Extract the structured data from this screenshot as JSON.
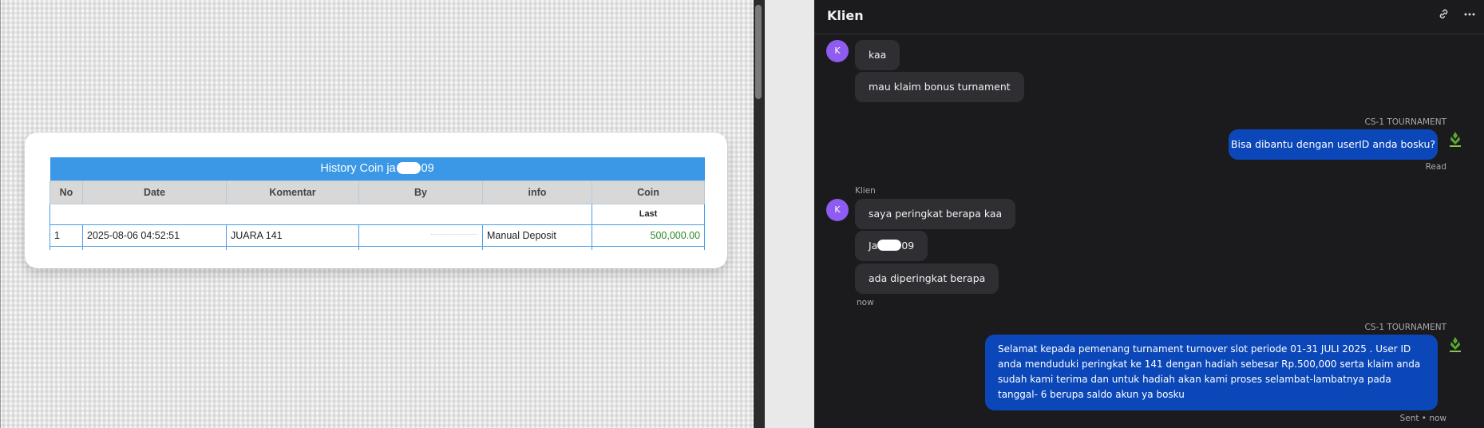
{
  "history": {
    "title_prefix": "History Coin ja",
    "title_suffix": "09",
    "columns": [
      "No",
      "Date",
      "Komentar",
      "By",
      "info",
      "Coin"
    ],
    "sub_header": "Last",
    "rows": [
      {
        "no": "1",
        "date": "2025-08-06 04:52:51",
        "komentar": "JUARA 141",
        "by": "",
        "info": "Manual Deposit",
        "coin": "500,000.00"
      }
    ]
  },
  "chat": {
    "title": "Klien",
    "header_icons": [
      "link-icon",
      "more-icon"
    ],
    "client_avatar_letter": "K",
    "client_name": "Klien",
    "agent_name": "CS-1 TOURNAMENT",
    "messages": {
      "m1": "kaa",
      "m2": "mau klaim bonus turnament",
      "m3": "Bisa dibantu dengan userID anda bosku?",
      "m3_status": "Read",
      "m4": "saya peringkat berapa kaa",
      "m5_prefix": "Ja",
      "m5_suffix": "09",
      "m6": "ada diperingkat berapa",
      "m6_time": "now",
      "m7": "Selamat kepada pemenang turnament turnover slot periode 01-31 JULI 2025 . User ID anda menduduki peringkat ke 141 dengan hadiah sebesar Rp.500,000 serta klaim anda sudah kami terima dan untuk hadiah akan kami proses selambat-lambatnya pada tanggal- 6 berupa saldo akun ya bosku",
      "m7_status": "Sent • now"
    }
  },
  "colors": {
    "table_header_blue": "#3b98e6",
    "coin_green": "#2a8a2a",
    "chat_bg": "#1b1b1e",
    "outgoing_bubble": "#0b47b8",
    "incoming_bubble": "#2f2f33",
    "avatar_purple": "#8e5cf0"
  }
}
